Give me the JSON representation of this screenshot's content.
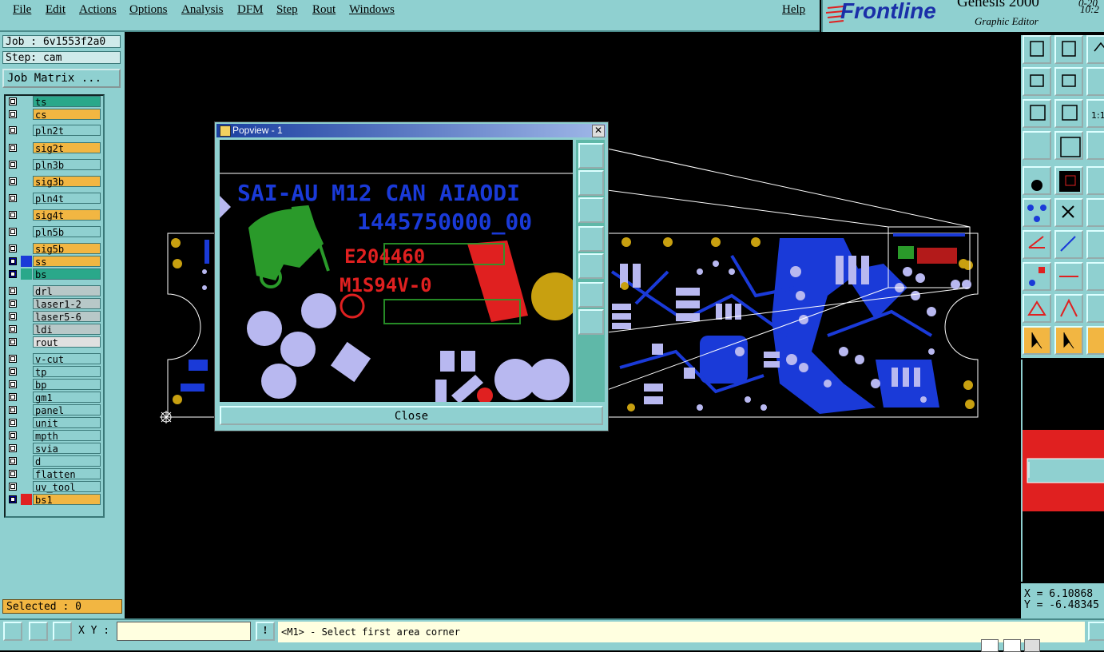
{
  "menu": {
    "items": [
      "File",
      "Edit",
      "Actions",
      "Options",
      "Analysis",
      "DFM",
      "Step",
      "Rout",
      "Windows"
    ],
    "help": "Help"
  },
  "brand": {
    "logo": "Frontline",
    "product": "Genesis 2000",
    "subtitle": "Graphic Editor",
    "clock_top": "0-20",
    "clock": "10:2"
  },
  "job": {
    "label": "Job : 6v1553f2a0",
    "step": "Step: cam",
    "matrix_button": "Job Matrix ..."
  },
  "layers": [
    {
      "name": "ts",
      "color": "#2aa88a",
      "on": false
    },
    {
      "name": "cs",
      "color": "#f2b642",
      "on": false
    },
    {
      "name": "pln2t",
      "color": "#8fd0d0",
      "on": false
    },
    {
      "name": "sig2t",
      "color": "#f2b642",
      "on": false
    },
    {
      "name": "pln3b",
      "color": "#8fd0d0",
      "on": false
    },
    {
      "name": "sig3b",
      "color": "#f2b642",
      "on": false
    },
    {
      "name": "pln4t",
      "color": "#8fd0d0",
      "on": false
    },
    {
      "name": "sig4t",
      "color": "#f2b642",
      "on": false
    },
    {
      "name": "pln5b",
      "color": "#8fd0d0",
      "on": false
    },
    {
      "name": "sig5b",
      "color": "#f2b642",
      "on": false
    },
    {
      "name": "ss",
      "color": "#f2b642",
      "on": true,
      "swatch": "#1a3ad8"
    },
    {
      "name": "bs",
      "color": "#2aa88a",
      "on": true,
      "swatch": "#2aa88a"
    },
    {
      "name": "drl",
      "color": "#b8c8c8",
      "on": false
    },
    {
      "name": "laser1-2",
      "color": "#b8c8c8",
      "on": false
    },
    {
      "name": "laser5-6",
      "color": "#b8c8c8",
      "on": false
    },
    {
      "name": "ldi",
      "color": "#b8c8c8",
      "on": false
    },
    {
      "name": "rout",
      "color": "#e0e0e0",
      "on": false
    },
    {
      "name": "v-cut",
      "color": "#8fd0d0",
      "on": false
    },
    {
      "name": "tp",
      "color": "#8fd0d0",
      "on": false
    },
    {
      "name": "bp",
      "color": "#8fd0d0",
      "on": false
    },
    {
      "name": "gm1",
      "color": "#8fd0d0",
      "on": false
    },
    {
      "name": "panel",
      "color": "#8fd0d0",
      "on": false
    },
    {
      "name": "unit",
      "color": "#8fd0d0",
      "on": false
    },
    {
      "name": "mpth",
      "color": "#8fd0d0",
      "on": false
    },
    {
      "name": "svia",
      "color": "#8fd0d0",
      "on": false
    },
    {
      "name": "d",
      "color": "#8fd0d0",
      "on": false
    },
    {
      "name": "flatten",
      "color": "#8fd0d0",
      "on": false
    },
    {
      "name": "uv_tool",
      "color": "#8fd0d0",
      "on": false
    },
    {
      "name": "bs1",
      "color": "#f2b642",
      "on": true,
      "swatch": "#e02020"
    }
  ],
  "selected": "Selected : 0",
  "popview": {
    "title": "Popview - 1",
    "close_label": "Close",
    "text_line1": "SAI-AU M12 CAN AIAODI",
    "text_line2": "1445750000_00",
    "text_red": "E204460",
    "text_red2": "M1S94V-0"
  },
  "coords": {
    "x": "X = 6.10868",
    "y": "Y = -6.48345"
  },
  "bottom": {
    "xy_label": "X Y :",
    "xy_value": "",
    "message": "<M1> - Select first area corner"
  },
  "colors": {
    "panel": "#8fd0d0",
    "accent": "#f2b642",
    "copper": "#1a3ad8",
    "pad": "#b8b8f0"
  }
}
